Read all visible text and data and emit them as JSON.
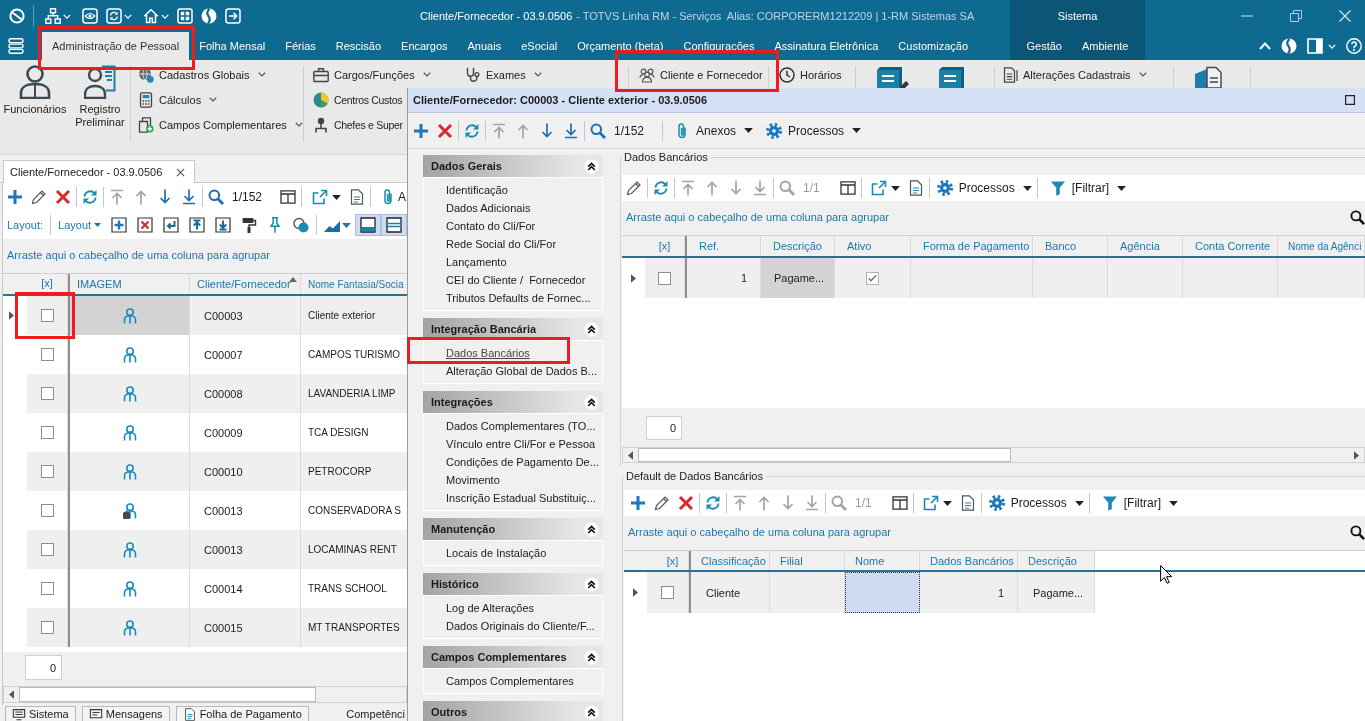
{
  "title_bar": {
    "title": "Cliente/Fornecedor - 03.9.0506",
    "details": "- TOTVS Linha RM - Serviços  Alias: CORPORERM1212209 | 1-RM Sistemas SA",
    "context_group": "Sistema"
  },
  "ribbon_tabs": [
    {
      "label": "Administração de Pessoal",
      "selected": true
    },
    {
      "label": "Folha Mensal",
      "selected": false
    },
    {
      "label": "Férias",
      "selected": false
    },
    {
      "label": "Rescisão",
      "selected": false
    },
    {
      "label": "Encargos",
      "selected": false
    },
    {
      "label": "Anuais",
      "selected": false
    },
    {
      "label": "eSocial",
      "selected": false
    },
    {
      "label": "Orçamento (beta)",
      "selected": false
    },
    {
      "label": "Configurações",
      "selected": false
    },
    {
      "label": "Assinatura Eletrônica",
      "selected": false
    },
    {
      "label": "Customização",
      "selected": false
    }
  ],
  "context_tabs": [
    {
      "label": "Gestão",
      "selected": false
    },
    {
      "label": "Ambiente",
      "selected": false
    }
  ],
  "ribbon": {
    "large_buttons": [
      {
        "label": "Funcionários"
      },
      {
        "label": "Registro Preliminar"
      }
    ],
    "menu_column_1": [
      {
        "label": "Cadastros Globais",
        "dropdown": true
      },
      {
        "label": "Cálculos",
        "dropdown": true
      },
      {
        "label": "Campos Complementares",
        "dropdown": true
      }
    ],
    "menu_column_2": [
      {
        "label": "Cargos/Funções",
        "dropdown": true
      },
      {
        "label": "Centros Custos",
        "dropdown": false
      },
      {
        "label": "Chefes e Super",
        "dropdown": false
      }
    ],
    "top_row": [
      {
        "label": "Exames",
        "dropdown": true
      },
      {
        "label": "Cliente e Fornecedor",
        "dropdown": false
      },
      {
        "label": "Horários",
        "dropdown": false
      },
      {
        "label": "Alterações Cadastrais",
        "dropdown": true
      }
    ]
  },
  "client_list": {
    "tab": "Cliente/Fornecedor - 03.9.0506",
    "toolbar": {
      "counter": "1/152",
      "navigation": [
        {
          "disabled": true
        },
        {
          "disabled": true
        },
        {
          "disabled": false
        },
        {
          "disabled": false
        }
      ],
      "search_disabled": false,
      "attachments": "A"
    },
    "layout_bar": {
      "label": "Layout:",
      "menu": "Layout",
      "view_toggles": [
        {
          "selected": true
        },
        {
          "selected": true
        }
      ]
    },
    "group_hint": "Arraste aqui o cabeçalho de uma coluna para agrupar",
    "grid": {
      "active": false,
      "columns": [
        {
          "label": "[x]",
          "kind": "select",
          "sorted": false,
          "focused": false
        },
        {
          "label": "IMAGEM",
          "kind": "icon",
          "sorted": false,
          "focused": true
        },
        {
          "label": "Cliente/Fornecedor",
          "kind": "text",
          "sorted": true,
          "focused": false
        },
        {
          "label": "Nome Fantasia/Socia",
          "kind": "text",
          "sorted": false,
          "focused": false
        }
      ],
      "rows": [
        {
          "selected": true,
          "kind": "person",
          "cells": [
            false,
            null,
            "C00003",
            "Cliente exterior"
          ]
        },
        {
          "selected": false,
          "kind": "person",
          "cells": [
            false,
            null,
            "C00007",
            "CAMPOS TURISMO"
          ]
        },
        {
          "selected": false,
          "kind": "person",
          "cells": [
            false,
            null,
            "C00008",
            "LAVANDERIA LIMP"
          ]
        },
        {
          "selected": false,
          "kind": "person",
          "cells": [
            false,
            null,
            "C00009",
            "TCA DESIGN"
          ]
        },
        {
          "selected": false,
          "kind": "person",
          "cells": [
            false,
            null,
            "C00010",
            "PETROCORP"
          ]
        },
        {
          "selected": false,
          "kind": "person-badge",
          "cells": [
            false,
            null,
            "C00013",
            "CONSERVADORA S"
          ]
        },
        {
          "selected": false,
          "kind": "person",
          "cells": [
            false,
            null,
            "C00013",
            "LOCAMINAS RENT"
          ]
        },
        {
          "selected": false,
          "kind": "person",
          "cells": [
            false,
            null,
            "C00014",
            "TRANS SCHOOL"
          ]
        },
        {
          "selected": false,
          "kind": "person",
          "cells": [
            false,
            null,
            "C00015",
            "MT TRANSPORTES"
          ]
        }
      ]
    },
    "record_count": "0"
  },
  "status_bar": {
    "tabs": [
      {
        "label": "Sistema"
      },
      {
        "label": "Mensagens"
      },
      {
        "label": "Folha de Pagamento"
      }
    ],
    "competence": "Competênci"
  },
  "dialog": {
    "title": "Cliente/Fornecedor: C00003 - Cliente exterior - 03.9.0506",
    "toolbar": {
      "counter": "1/152",
      "navigation": [
        {
          "disabled": true
        },
        {
          "disabled": true
        },
        {
          "disabled": false
        },
        {
          "disabled": false
        }
      ],
      "search_disabled": false,
      "attachments": "Anexos",
      "processes": "Processos"
    },
    "navigation": [
      {
        "title": "Dados Gerais",
        "expanded": true,
        "items": [
          {
            "label": "Identificação",
            "selected": false
          },
          {
            "label": "Dados Adicionais",
            "selected": false
          },
          {
            "label": "Contato do Cli/For",
            "selected": false
          },
          {
            "label": "Rede Social do Cli/For",
            "selected": false
          },
          {
            "label": "Lançamento",
            "selected": false
          },
          {
            "label": "CEI do Cliente /  Fornecedor",
            "selected": false
          },
          {
            "label": "Tributos Defaults de Fornec...",
            "selected": false
          }
        ]
      },
      {
        "title": "Integração Bancária",
        "expanded": true,
        "items": [
          {
            "label": "Dados Bancários",
            "selected": true
          },
          {
            "label": "Alteração Global de Dados B...",
            "selected": false
          }
        ]
      },
      {
        "title": "Integrações",
        "expanded": true,
        "items": [
          {
            "label": "Dados Complementares (TO...",
            "selected": false
          },
          {
            "label": "Vínculo entre Cli/For e Pessoa",
            "selected": false
          },
          {
            "label": "Condições de Pagamento De...",
            "selected": false
          },
          {
            "label": "Movimento",
            "selected": false
          },
          {
            "label": "Inscrição Estadual Substituiç...",
            "selected": false
          }
        ]
      },
      {
        "title": "Manutenção",
        "expanded": true,
        "items": [
          {
            "label": "Locais de Instalação",
            "selected": false
          }
        ]
      },
      {
        "title": "Histórico",
        "expanded": true,
        "items": [
          {
            "label": "Log de Alterações",
            "selected": false
          },
          {
            "label": "Dados Originais do Cliente/F...",
            "selected": false
          }
        ]
      },
      {
        "title": "Campos Complementares",
        "expanded": true,
        "items": [
          {
            "label": "Campos Complementares",
            "selected": false
          }
        ]
      },
      {
        "title": "Outros",
        "expanded": true
      }
    ],
    "bank_data": {
      "title": "Dados Bancários",
      "toolbar": {
        "counter": "1/1",
        "navigation": [
          {
            "disabled": true
          },
          {
            "disabled": true
          },
          {
            "disabled": true
          },
          {
            "disabled": true
          }
        ],
        "search_disabled": true,
        "processes": "Processos",
        "filter": "[Filtrar]"
      },
      "group_hint": "Arraste aqui o cabeçalho de uma coluna para agrupar",
      "grid": {
        "active": false,
        "columns": [
          {
            "label": "[x]",
            "kind": "select",
            "focused": false
          },
          {
            "label": "Ref.",
            "kind": "number",
            "focused": false
          },
          {
            "label": "Descrição",
            "kind": "text",
            "focused": true
          },
          {
            "label": "Ativo",
            "kind": "flag",
            "focused": false
          },
          {
            "label": "Forma de Pagamento",
            "kind": "text",
            "focused": false
          },
          {
            "label": "Banco",
            "kind": "text",
            "focused": false
          },
          {
            "label": "Agência",
            "kind": "text",
            "focused": false
          },
          {
            "label": "Conta Corrente",
            "kind": "text",
            "focused": false
          },
          {
            "label": "Nome da Agênci",
            "kind": "text",
            "focused": false
          }
        ],
        "rows": [
          {
            "selected": true,
            "cells": [
              false,
              "1",
              "Pagame...",
              true
            ]
          }
        ]
      },
      "record_count": "0"
    },
    "default_bank_data": {
      "title": "Default de Dados Bancários",
      "toolbar": {
        "counter": "1/1",
        "navigation": [
          {
            "disabled": true
          },
          {
            "disabled": true
          },
          {
            "disabled": true
          },
          {
            "disabled": true
          }
        ],
        "search_disabled": true,
        "processes": "Processos",
        "filter": "[Filtrar]"
      },
      "group_hint": "Arraste aqui o cabeçalho de uma coluna para agrupar",
      "grid": {
        "active": true,
        "columns": [
          {
            "label": "[x]",
            "kind": "select",
            "focused": false
          },
          {
            "label": "Classificação",
            "kind": "text",
            "focused": false
          },
          {
            "label": "Filial",
            "kind": "text",
            "focused": false
          },
          {
            "label": "Nome",
            "kind": "text",
            "focused": true
          },
          {
            "label": "Dados Bancários",
            "kind": "number",
            "focused": false
          },
          {
            "label": "Descrição",
            "kind": "text",
            "focused": false
          }
        ],
        "rows": [
          {
            "selected": true,
            "cells": [
              false,
              "Cliente",
              null,
              null,
              "1",
              "Pagame..."
            ]
          }
        ]
      }
    }
  }
}
